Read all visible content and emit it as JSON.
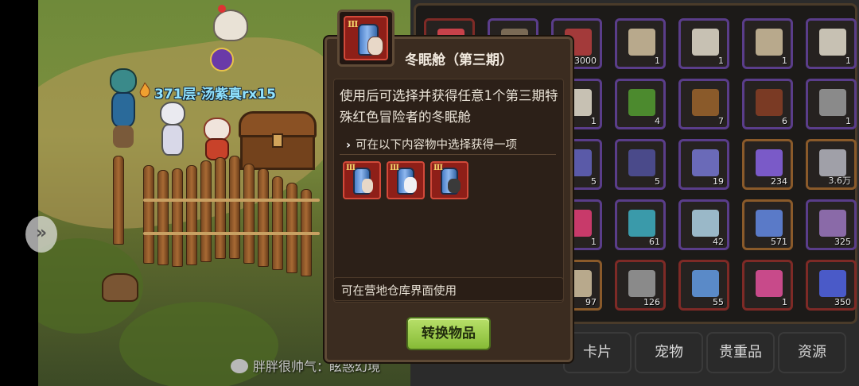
{
  "scene": {
    "player_label": "371层·汤紫真rx15",
    "chat_text": "胖胖很帅气：眩惑幻境",
    "nav_arrow_glyph": "»"
  },
  "popup": {
    "title": "冬眠舱（第三期）",
    "icon_roman": "III",
    "description": "使用后可选择并获得任意1个第三期特殊红色冒险者的冬眠舱",
    "choose_prefix": "›",
    "choose_text": "可在以下内容物中选择获得一项",
    "options": [
      {
        "roman": "III"
      },
      {
        "roman": "III"
      },
      {
        "roman": "III"
      }
    ],
    "usage_text": "可在营地仓库界面使用",
    "convert_button": "转换物品"
  },
  "inventory": {
    "slots": [
      {
        "row": 0,
        "col": 0,
        "count": "",
        "rarity": "red",
        "icon": "capsule-icon",
        "color": "#c8424a"
      },
      {
        "row": 0,
        "col": 1,
        "count": "",
        "rarity": "purple",
        "icon": "item-icon",
        "color": "#7a6a55"
      },
      {
        "row": 0,
        "col": 2,
        "count": "3000",
        "rarity": "purple",
        "icon": "bag-icon",
        "color": "#a33a3a"
      },
      {
        "row": 0,
        "col": 3,
        "count": "1",
        "rarity": "purple",
        "icon": "map-icon",
        "color": "#b8a98c"
      },
      {
        "row": 0,
        "col": 4,
        "count": "1",
        "rarity": "purple",
        "icon": "scroll-icon",
        "color": "#c7c1b3"
      },
      {
        "row": 0,
        "col": 5,
        "count": "1",
        "rarity": "purple",
        "icon": "map-icon",
        "color": "#b8a98c"
      },
      {
        "row": 0,
        "col": 6,
        "count": "1",
        "rarity": "purple",
        "icon": "scroll-icon",
        "color": "#c7c1b3"
      },
      {
        "row": 1,
        "col": 2,
        "count": "1",
        "rarity": "purple",
        "icon": "scroll-icon",
        "color": "#c7c1b3"
      },
      {
        "row": 1,
        "col": 3,
        "count": "4",
        "rarity": "purple",
        "icon": "moss-icon",
        "color": "#4c8a2e"
      },
      {
        "row": 1,
        "col": 4,
        "count": "7",
        "rarity": "purple",
        "icon": "wood-icon",
        "color": "#8a5a2a"
      },
      {
        "row": 1,
        "col": 5,
        "count": "6",
        "rarity": "purple",
        "icon": "leather-icon",
        "color": "#7a3a24"
      },
      {
        "row": 1,
        "col": 6,
        "count": "1",
        "rarity": "purple",
        "icon": "gear-icon",
        "color": "#8a8a8a"
      },
      {
        "row": 2,
        "col": 2,
        "count": "5",
        "rarity": "purple",
        "icon": "crystal-icon",
        "color": "#5a5aa8"
      },
      {
        "row": 2,
        "col": 3,
        "count": "5",
        "rarity": "purple",
        "icon": "crystal-icon",
        "color": "#4a4a8a"
      },
      {
        "row": 2,
        "col": 4,
        "count": "19",
        "rarity": "purple",
        "icon": "crystal-icon",
        "color": "#6a6ab8"
      },
      {
        "row": 2,
        "col": 5,
        "count": "234",
        "rarity": "gold",
        "icon": "crystal-icon",
        "color": "#7a5ac8"
      },
      {
        "row": 2,
        "col": 6,
        "count": "3.6万",
        "rarity": "gold",
        "icon": "ingot-icon",
        "color": "#a0a0a8"
      },
      {
        "row": 3,
        "col": 2,
        "count": "1",
        "rarity": "purple",
        "icon": "gem-icon",
        "color": "#c83a6a"
      },
      {
        "row": 3,
        "col": 3,
        "count": "61",
        "rarity": "purple",
        "icon": "serpent-icon",
        "color": "#3a9aaa"
      },
      {
        "row": 3,
        "col": 4,
        "count": "42",
        "rarity": "purple",
        "icon": "diamond-icon",
        "color": "#9ab8c8"
      },
      {
        "row": 3,
        "col": 5,
        "count": "571",
        "rarity": "gold",
        "icon": "hourglass-icon",
        "color": "#5a7ac8"
      },
      {
        "row": 3,
        "col": 6,
        "count": "325",
        "rarity": "purple",
        "icon": "orb-icon",
        "color": "#8a6aa8"
      },
      {
        "row": 4,
        "col": 2,
        "count": "97",
        "rarity": "gold",
        "icon": "map-icon",
        "color": "#b8a98c"
      },
      {
        "row": 4,
        "col": 3,
        "count": "126",
        "rarity": "red",
        "icon": "book-icon",
        "color": "#8a8a8a"
      },
      {
        "row": 4,
        "col": 4,
        "count": "55",
        "rarity": "red",
        "icon": "potion-icon",
        "color": "#5a8ac8"
      },
      {
        "row": 4,
        "col": 5,
        "count": "1",
        "rarity": "red",
        "icon": "flask-icon",
        "color": "#c84a8a"
      },
      {
        "row": 4,
        "col": 6,
        "count": "350",
        "rarity": "red",
        "icon": "crystal-icon",
        "color": "#4a5ac8"
      }
    ],
    "tabs": [
      {
        "label": "卡片"
      },
      {
        "label": "宠物"
      },
      {
        "label": "贵重品"
      },
      {
        "label": "资源"
      }
    ]
  }
}
